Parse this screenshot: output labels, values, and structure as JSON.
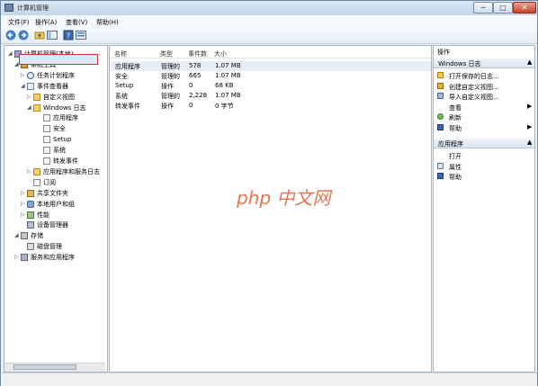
{
  "window": {
    "title": "计算机管理",
    "controls": {
      "min": "─",
      "max": "□",
      "close": "✕"
    }
  },
  "menu": [
    "文件(F)",
    "操作(A)",
    "查看(V)",
    "帮助(H)"
  ],
  "tree": [
    {
      "label": "计算机管理(本地)",
      "icon": "computer-icon",
      "twisty": "◢"
    },
    {
      "label": "系统工具",
      "icon": "tools-icon",
      "twisty": "◢"
    },
    {
      "label": "任务计划程序",
      "icon": "clock-icon",
      "twisty": "▷"
    },
    {
      "label": "事件查看器",
      "icon": "event-viewer-icon",
      "twisty": "◢"
    },
    {
      "label": "自定义视图",
      "icon": "folder-icon",
      "twisty": "▷"
    },
    {
      "label": "Windows 日志",
      "icon": "folder-icon",
      "twisty": "◢"
    },
    {
      "label": "应用程序",
      "icon": "log-icon",
      "twisty": ""
    },
    {
      "label": "安全",
      "icon": "log-icon",
      "twisty": ""
    },
    {
      "label": "Setup",
      "icon": "log-icon",
      "twisty": ""
    },
    {
      "label": "系统",
      "icon": "log-icon",
      "twisty": ""
    },
    {
      "label": "转发事件",
      "icon": "log-icon",
      "twisty": ""
    },
    {
      "label": "应用程序和服务日志",
      "icon": "folder-icon",
      "twisty": "▷"
    },
    {
      "label": "订阅",
      "icon": "log-icon",
      "twisty": ""
    },
    {
      "label": "共享文件夹",
      "icon": "shared-folder-icon",
      "twisty": "▷"
    },
    {
      "label": "本地用户和组",
      "icon": "users-icon",
      "twisty": "▷"
    },
    {
      "label": "性能",
      "icon": "performance-icon",
      "twisty": "▷"
    },
    {
      "label": "设备管理器",
      "icon": "device-manager-icon",
      "twisty": ""
    },
    {
      "label": "存储",
      "icon": "storage-icon",
      "twisty": "◢"
    },
    {
      "label": "磁盘管理",
      "icon": "disk-icon",
      "twisty": ""
    },
    {
      "label": "服务和应用程序",
      "icon": "services-icon",
      "twisty": "▷"
    }
  ],
  "list": {
    "columns": [
      "名称",
      "类型",
      "事件数",
      "大小"
    ],
    "rows": [
      [
        "应用程序",
        "管理的",
        "578",
        "1.07 MB"
      ],
      [
        "安全",
        "管理的",
        "665",
        "1.07 MB"
      ],
      [
        "Setup",
        "操作",
        "0",
        "68 KB"
      ],
      [
        "系统",
        "管理的",
        "2,228",
        "1.07 MB"
      ],
      [
        "转发事件",
        "操作",
        "0",
        "0 字节"
      ]
    ]
  },
  "actions": {
    "title": "操作",
    "sections": [
      {
        "header": "Windows 日志",
        "items": [
          {
            "label": "打开保存的日志...",
            "icon": "open-log-icon",
            "arrow": ""
          },
          {
            "label": "创建自定义视图...",
            "icon": "filter-icon",
            "arrow": ""
          },
          {
            "label": "导入自定义视图...",
            "icon": "import-icon",
            "arrow": ""
          },
          {
            "label": "查看",
            "icon": "",
            "arrow": "▶"
          },
          {
            "label": "刷新",
            "icon": "refresh-icon",
            "arrow": ""
          },
          {
            "label": "帮助",
            "icon": "help-icon",
            "arrow": "▶"
          }
        ]
      },
      {
        "header": "应用程序",
        "items": [
          {
            "label": "打开",
            "icon": "",
            "arrow": ""
          },
          {
            "label": "属性",
            "icon": "properties-icon",
            "arrow": ""
          },
          {
            "label": "帮助",
            "icon": "help-icon",
            "arrow": ""
          }
        ]
      }
    ]
  },
  "watermark": "php 中文网"
}
